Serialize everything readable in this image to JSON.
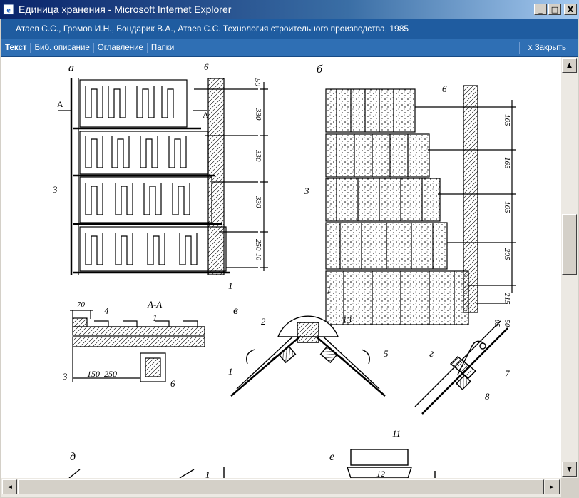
{
  "window": {
    "title": "Единица хранения - Microsoft Internet Explorer",
    "buttons": {
      "minimize": "_",
      "maximize": "□",
      "close": "X"
    }
  },
  "book": {
    "citation": "Атаев С.С., Громов И.Н., Бондарик В.А., Атаев С.С. Технология строительного производства, 1985"
  },
  "nav": {
    "links": [
      "Текст",
      "Биб. описание",
      "Оглавление",
      "Папки"
    ],
    "active": "Текст",
    "close_label": "x Закрыть"
  },
  "figure": {
    "panel_letters": [
      "а",
      "б",
      "в",
      "г",
      "д",
      "е"
    ],
    "section_label": "А-А",
    "cut_marker": "А",
    "dims_a": [
      "50",
      "330",
      "330",
      "330",
      "250",
      "10"
    ],
    "dims_b": [
      "165",
      "165",
      "165",
      "205",
      "215",
      "50",
      "65"
    ],
    "dims_aa_top": "70",
    "dims_aa_bottom": "150–250",
    "callouts": {
      "c1": "1",
      "c2": "2",
      "c3": "3",
      "c4": "4",
      "c5": "5",
      "c6": "6",
      "c7": "7",
      "c8": "8",
      "c11": "11",
      "c12": "12",
      "c13": "13"
    }
  },
  "scrollbars": {
    "vertical": {
      "up": "▲",
      "down": "▼",
      "position_fraction": 0.45
    },
    "horizontal": {
      "left": "◄",
      "right": "►"
    }
  }
}
